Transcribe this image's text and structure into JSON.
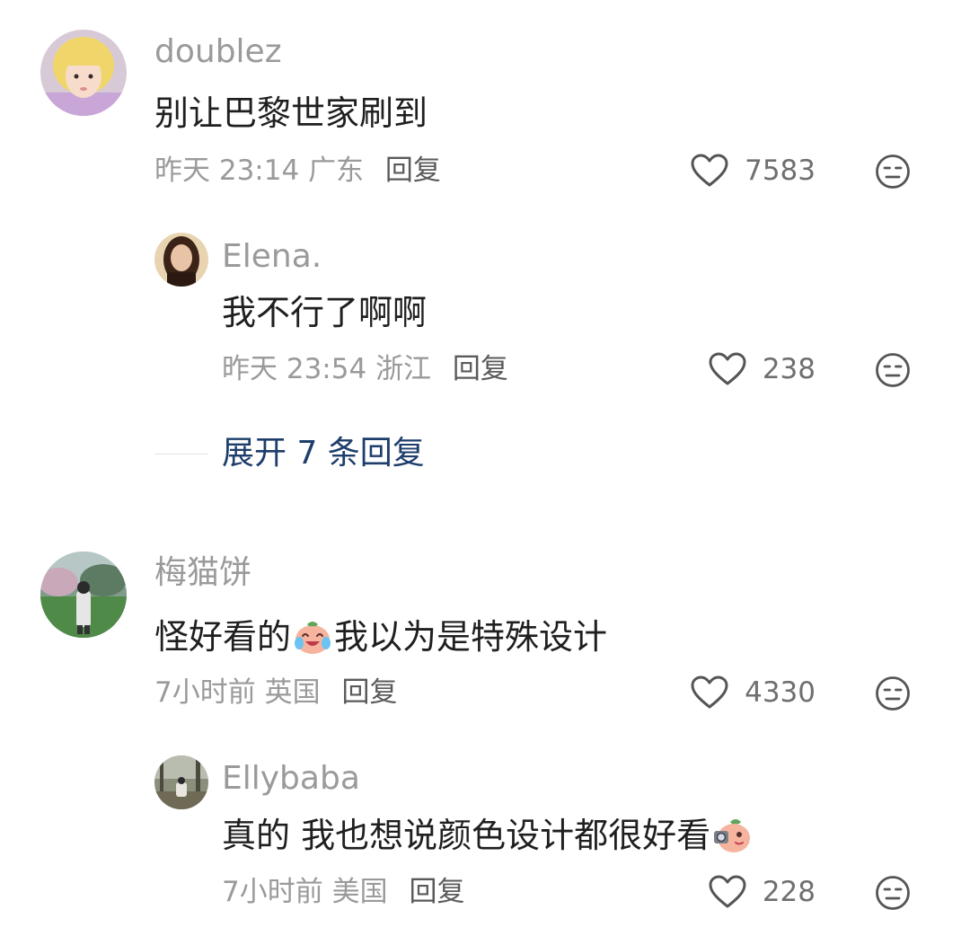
{
  "comments": [
    {
      "username": "doublez",
      "text": "别让巴黎世家刷到",
      "time": "昨天 23:14",
      "location": "广东",
      "reply_label": "回复",
      "likes": "7583",
      "avatar_icon": "avatar-blonde-girl",
      "replies": [
        {
          "username": "Elena.",
          "text": "我不行了啊啊",
          "time": "昨天 23:54",
          "location": "浙江",
          "reply_label": "回复",
          "likes": "238",
          "avatar_icon": "avatar-dark-hair-woman"
        }
      ],
      "expand_label": "展开 7 条回复"
    },
    {
      "username": "梅猫饼",
      "text_before_emoji": "怪好看的",
      "emoji": "crying-laughing-bun-emoji",
      "text_after_emoji": "我以为是特殊设计",
      "time": "7小时前",
      "location": "英国",
      "reply_label": "回复",
      "likes": "4330",
      "avatar_icon": "avatar-park-photo",
      "replies": [
        {
          "username": "Ellybaba",
          "text": "真的 我也想说颜色设计都很好看",
          "emoji": "camera-bun-emoji",
          "time": "7小时前",
          "location": "美国",
          "reply_label": "回复",
          "likes": "228",
          "avatar_icon": "avatar-forest-photo"
        }
      ]
    }
  ],
  "icons": {
    "like": "heart-outline-icon",
    "dislike": "meh-face-icon"
  },
  "colors": {
    "username": "#9a9a9a",
    "content": "#1f1f1f",
    "meta": "#9a9a9a",
    "expand_link": "#1d3d6b"
  }
}
